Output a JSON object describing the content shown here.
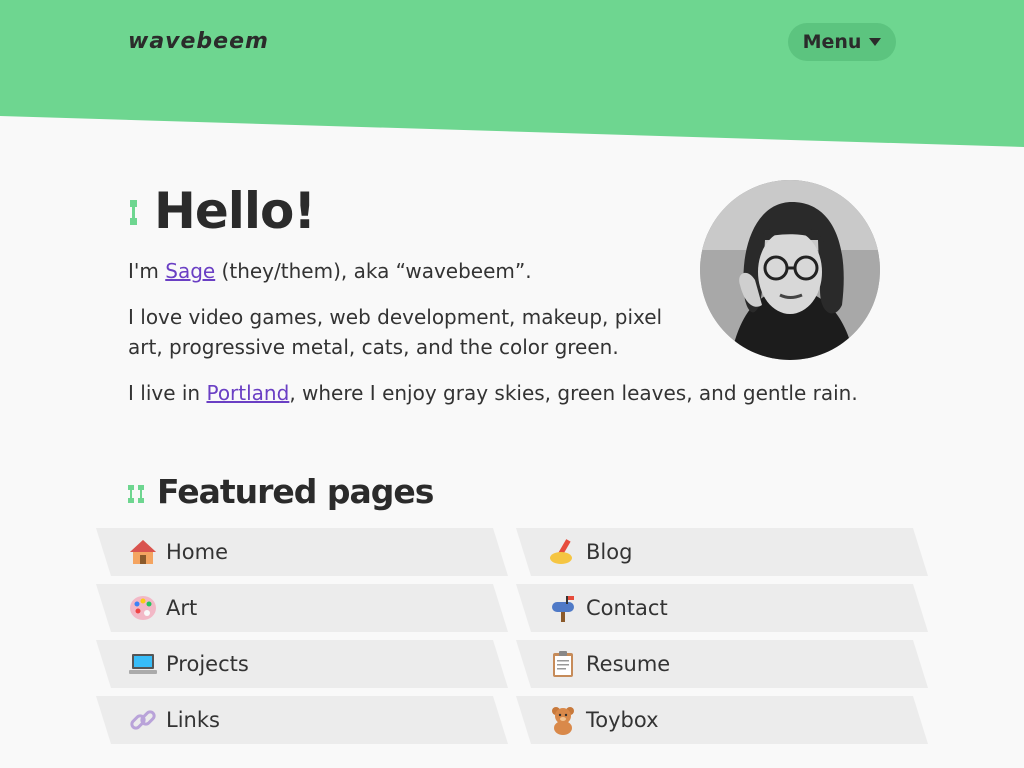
{
  "header": {
    "logo": "wavebeem",
    "menu_label": "Menu",
    "accent_color": "#6ed690"
  },
  "intro": {
    "title": "Hello!",
    "line1_before": "I'm ",
    "name_link": "Sage",
    "line1_after": " (they/them), aka “wavebeem”.",
    "line2": "I love video games, web development, makeup, pixel art, progressive metal, cats, and the color green.",
    "line3_before": "I live in ",
    "city_link": "Portland",
    "line3_after": ", where I enjoy gray skies, green leaves, and gentle rain.",
    "link_color": "#6a3fc4"
  },
  "featured": {
    "title": "Featured pages",
    "items": [
      {
        "label": "Home",
        "icon": "house-icon"
      },
      {
        "label": "Blog",
        "icon": "writing-hand-icon"
      },
      {
        "label": "Art",
        "icon": "palette-icon"
      },
      {
        "label": "Contact",
        "icon": "mailbox-icon"
      },
      {
        "label": "Projects",
        "icon": "laptop-icon"
      },
      {
        "label": "Resume",
        "icon": "clipboard-icon"
      },
      {
        "label": "Links",
        "icon": "link-icon"
      },
      {
        "label": "Toybox",
        "icon": "teddy-bear-icon"
      }
    ]
  }
}
